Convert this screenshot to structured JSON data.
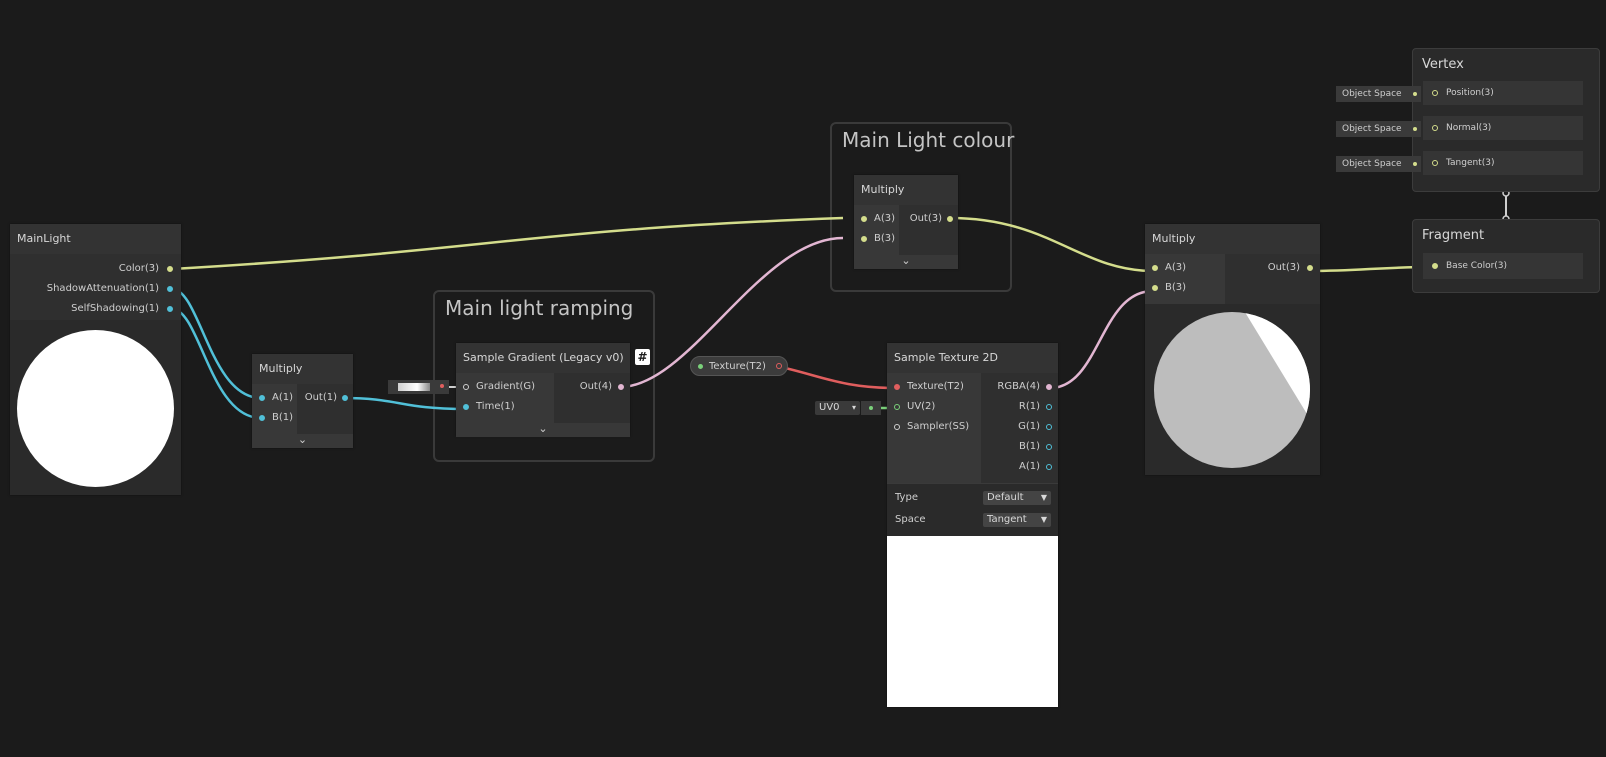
{
  "groups": {
    "main_light_colour": "Main Light colour",
    "main_light_ramping": "Main light ramping"
  },
  "main_light_node": {
    "title": "MainLight",
    "outputs": [
      "Color(3)",
      "ShadowAttenuation(1)",
      "SelfShadowing(1)"
    ]
  },
  "multiply_small": {
    "title": "Multiply",
    "inputs": [
      "A(1)",
      "B(1)"
    ],
    "output": "Out(1)"
  },
  "sample_gradient": {
    "title": "Sample Gradient (Legacy v0)",
    "inputs": [
      "Gradient(G)",
      "Time(1)"
    ],
    "output": "Out(4)",
    "badge": "#"
  },
  "multiply_colour": {
    "title": "Multiply",
    "inputs": [
      "A(3)",
      "B(3)"
    ],
    "output": "Out(3)"
  },
  "texture_property": {
    "label": "Texture(T2)"
  },
  "uv_field": {
    "label": "UV0",
    "caret": "▾"
  },
  "sample_texture": {
    "title": "Sample Texture 2D",
    "inputs": [
      "Texture(T2)",
      "UV(2)",
      "Sampler(SS)"
    ],
    "outputs": [
      "RGBA(4)",
      "R(1)",
      "G(1)",
      "B(1)",
      "A(1)"
    ],
    "type_label": "Type",
    "type_value": "Default",
    "space_label": "Space",
    "space_value": "Tangent"
  },
  "multiply_final": {
    "title": "Multiply",
    "inputs": [
      "A(3)",
      "B(3)"
    ],
    "output": "Out(3)"
  },
  "vertex": {
    "title": "Vertex",
    "ports": [
      "Position(3)",
      "Normal(3)",
      "Tangent(3)"
    ],
    "space_fields": [
      "Object Space",
      "Object Space",
      "Object Space"
    ]
  },
  "fragment": {
    "title": "Fragment",
    "ports": [
      "Base Color(3)"
    ]
  },
  "colors": {
    "background": "#1b1b1b",
    "vector3_wire": "#d4dd8c",
    "float_wire": "#51c0d8",
    "vector4_wire": "#e2b6d2",
    "texture_wire": "#e05e5e",
    "uv_wire": "#7ad07a"
  },
  "icons": {
    "expand": "chevron-down-icon",
    "dropdown": "caret-down-icon"
  }
}
